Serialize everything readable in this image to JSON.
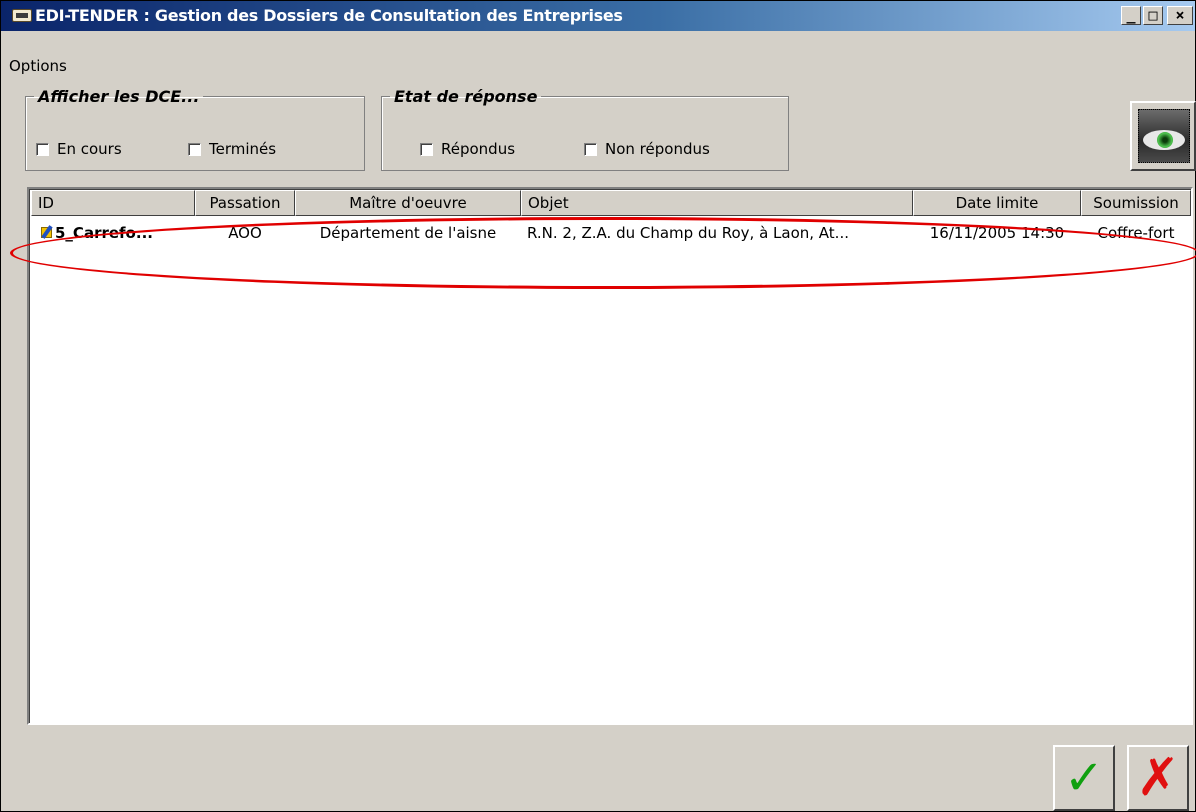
{
  "window": {
    "title": "EDI-TENDER : Gestion des Dossiers de Consultation des Entreprises",
    "controls": {
      "minimize": "_",
      "maximize": "□",
      "close": "×"
    }
  },
  "menu": {
    "options_label": "Options"
  },
  "filters": {
    "afficher": {
      "legend": "Afficher les DCE...",
      "en_cours": {
        "label": "En cours",
        "checked": false
      },
      "termines": {
        "label": "Terminés",
        "checked": false
      }
    },
    "etat": {
      "legend": "Etat de réponse",
      "repondus": {
        "label": "Répondus",
        "checked": false
      },
      "non_repondus": {
        "label": "Non répondus",
        "checked": false
      }
    }
  },
  "table": {
    "columns": [
      "ID",
      "Passation",
      "Maître d'oeuvre",
      "Objet",
      "Date limite",
      "Soumission"
    ],
    "rows": [
      {
        "id": "5_Carrefo...",
        "passation": "AOO",
        "maitre_oeuvre": "Département de l'aisne",
        "objet": "R.N. 2, Z.A. du Champ du Roy, à Laon, At...",
        "date_limite": "16/11/2005 14:30",
        "soumission": "Coffre-fort"
      }
    ]
  },
  "icons": {
    "app": "card-icon",
    "view": "eye-icon",
    "row": "pencil-folder-icon",
    "ok": "checkmark-icon",
    "cancel": "cross-icon"
  },
  "colors": {
    "highlight_ellipse": "#e00000",
    "ok_glyph": "#10a010",
    "cancel_glyph": "#e01010"
  },
  "glyphs": {
    "ok": "✓",
    "cancel": "✗"
  }
}
